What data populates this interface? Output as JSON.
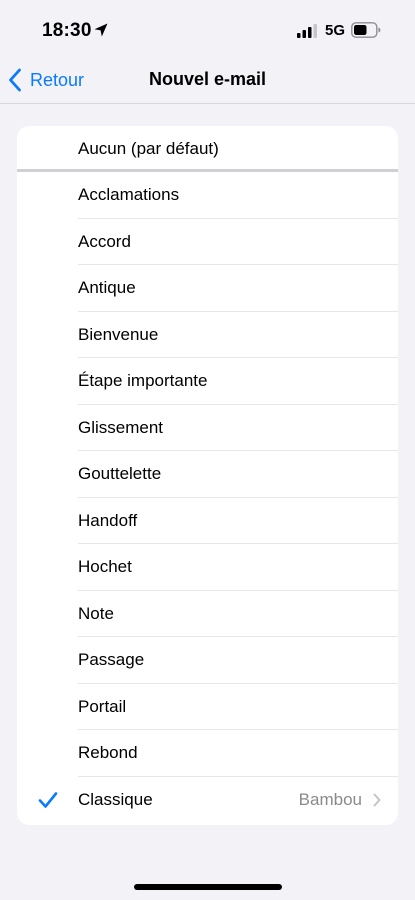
{
  "status_bar": {
    "time": "18:30",
    "network": "5G"
  },
  "nav": {
    "back_label": "Retour",
    "title": "Nouvel e-mail"
  },
  "list": {
    "default_item": "Aucun (par défaut)",
    "items": [
      "Acclamations",
      "Accord",
      "Antique",
      "Bienvenue",
      "Étape importante",
      "Glissement",
      "Gouttelette",
      "Handoff",
      "Hochet",
      "Note",
      "Passage",
      "Portail",
      "Rebond"
    ],
    "classic": {
      "label": "Classique",
      "value": "Bambou"
    }
  },
  "icons": {
    "location": "location-arrow-icon",
    "signal": "cellular-signal-icon",
    "battery": "battery-icon",
    "back": "chevron-left-icon",
    "check": "checkmark-icon",
    "disclosure": "chevron-right-icon"
  },
  "colors": {
    "accent": "#0a7aff",
    "background": "#f2f2f7",
    "secondary_text": "#8a8a8e"
  }
}
